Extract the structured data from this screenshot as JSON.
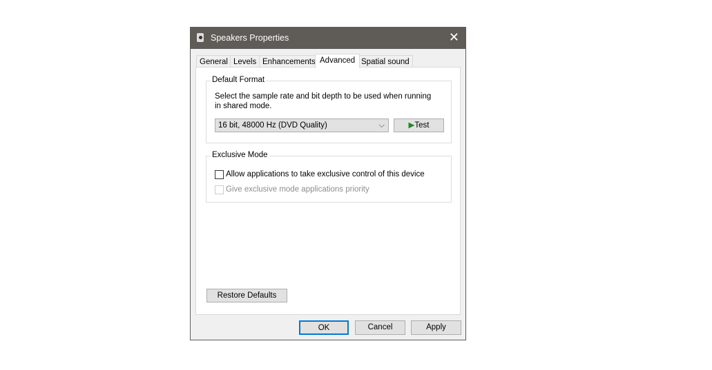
{
  "window": {
    "title": "Speakers Properties",
    "close": "✕"
  },
  "tabs": [
    "General",
    "Levels",
    "Enhancements",
    "Advanced",
    "Spatial sound"
  ],
  "default_format": {
    "legend": "Default Format",
    "description_line1": "Select the sample rate and bit depth to be used when running",
    "description_line2": "in shared mode.",
    "selected_format": "16 bit, 48000 Hz (DVD Quality)",
    "test_label": "Test"
  },
  "exclusive_mode": {
    "legend": "Exclusive Mode",
    "allow_label": "Allow applications to take exclusive control of this device",
    "allow_checked": false,
    "priority_label": "Give exclusive mode applications priority",
    "priority_enabled": false
  },
  "restore_label": "Restore Defaults",
  "footer": {
    "ok": "OK",
    "cancel": "Cancel",
    "apply": "Apply"
  },
  "colors": {
    "titlebar": "#5f5b57",
    "focus": "#0078d7",
    "play": "#1e8a1e"
  }
}
